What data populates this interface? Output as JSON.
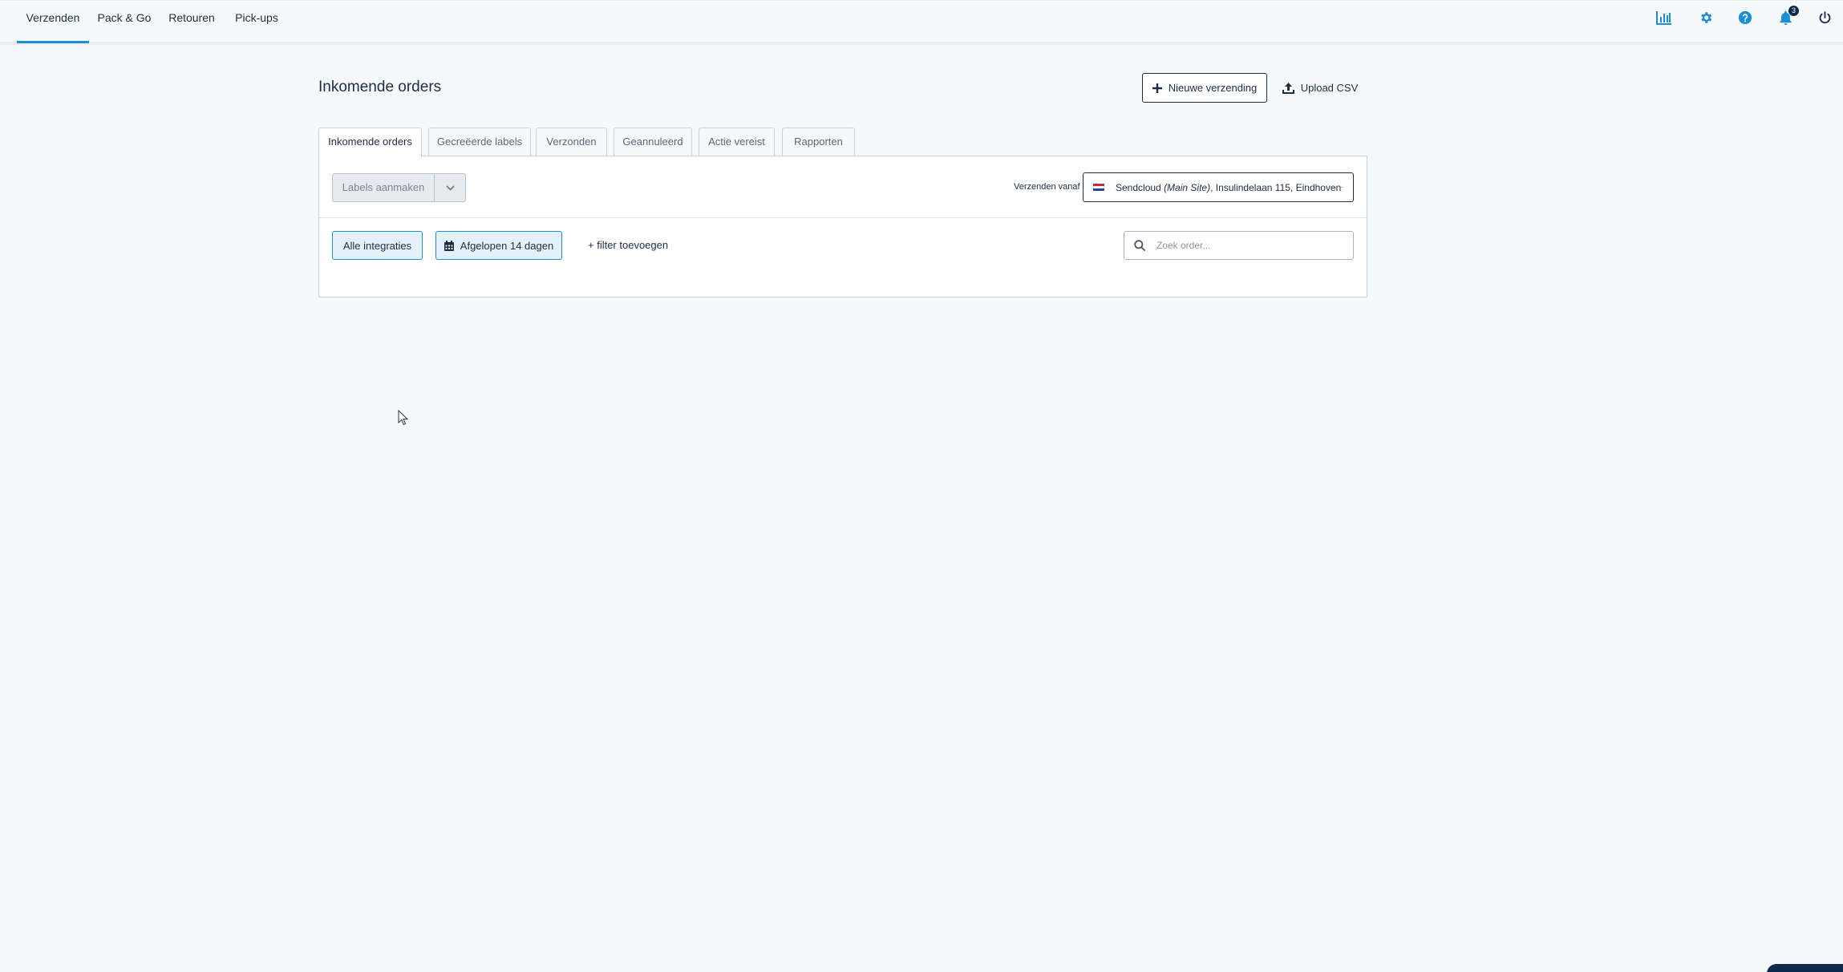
{
  "nav": {
    "items": [
      {
        "label": "Verzenden",
        "active": true
      },
      {
        "label": "Pack & Go",
        "active": false
      },
      {
        "label": "Retouren",
        "active": false
      },
      {
        "label": "Pick-ups",
        "active": false
      }
    ],
    "icons": [
      {
        "name": "analytics-icon"
      },
      {
        "name": "gear-icon"
      },
      {
        "name": "help-icon"
      },
      {
        "name": "bell-icon",
        "badge": "3"
      },
      {
        "name": "power-icon"
      }
    ],
    "accent": "#1a8fd8"
  },
  "header": {
    "title": "Inkomende orders",
    "new_shipment_label": "Nieuwe verzending",
    "upload_csv_label": "Upload CSV"
  },
  "tabs": [
    {
      "label": "Inkomende orders",
      "active": true
    },
    {
      "label": "Gecreëerde labels",
      "active": false
    },
    {
      "label": "Verzonden",
      "active": false
    },
    {
      "label": "Geannuleerd",
      "active": false
    },
    {
      "label": "Actie vereist",
      "active": false
    },
    {
      "label": "Rapporten",
      "active": false
    }
  ],
  "toolbar": {
    "create_labels_label": "Labels aanmaken",
    "ship_from_label": "Verzenden vanaf",
    "ship_from": {
      "company": "Sendcloud",
      "site": "(Main Site)",
      "address": ", Insulindelaan 115, Eindhoven"
    }
  },
  "filters": {
    "integrations_label": "Alle integraties",
    "date_range_label": "Afgelopen 14 dagen",
    "add_filter_label": "+ filter toevoegen",
    "search_placeholder": "Zoek order..."
  }
}
